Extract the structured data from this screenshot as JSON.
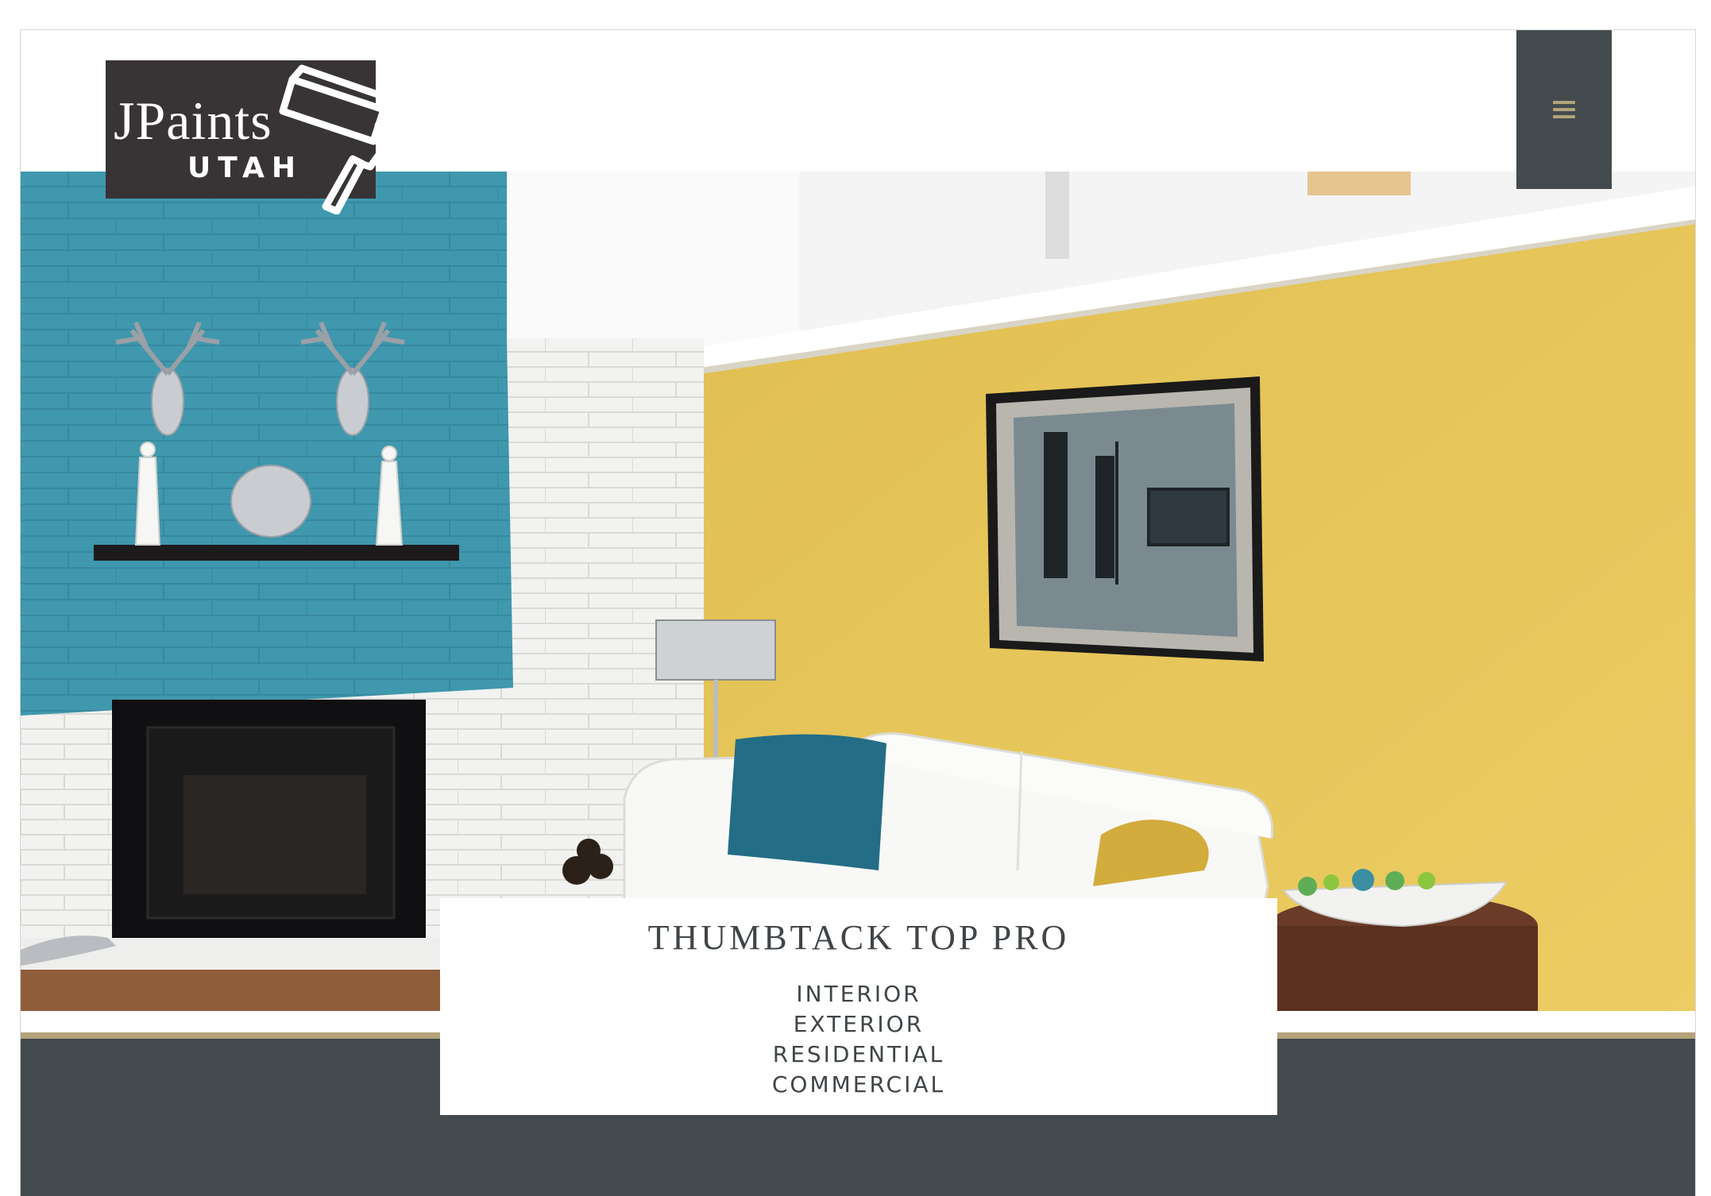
{
  "brand": {
    "name": "JPaints",
    "region": "UTAH"
  },
  "header": {
    "menu_icon": "hamburger-icon"
  },
  "hero": {
    "image_description_icon": "living-room-photo"
  },
  "card": {
    "title": "THUMBTACK TOP PRO",
    "services": [
      "INTERIOR",
      "EXTERIOR",
      "RESIDENTIAL",
      "COMMERCIAL"
    ]
  },
  "colors": {
    "accent_gold": "#b3a37a",
    "dark_slate": "#434b4f",
    "logo_bg": "#383435",
    "teal_wall": "#3f98ad",
    "yellow_wall": "#e8c65b"
  }
}
